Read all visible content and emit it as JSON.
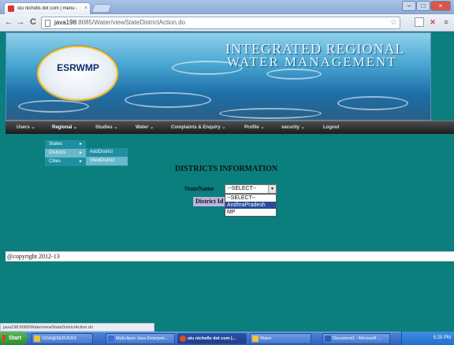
{
  "browser": {
    "tab_title": "stu nicholls dot com | menu - ",
    "tab_close": "×",
    "url_host": "java198",
    "url_rest": ":8085/Water/viewStateDistrictAction.do",
    "window_min": "–",
    "window_max": "□",
    "window_close": "×",
    "back": "←",
    "forward": "→",
    "reload": "C",
    "star": "☆"
  },
  "banner": {
    "logo_text": "ESRWMP",
    "title_line1": "INTEGRATED REGIONAL",
    "title_line2": "WATER MANAGEMENT"
  },
  "menu": {
    "items": [
      {
        "label": "Users ⌄"
      },
      {
        "label": "Regional ⌄"
      },
      {
        "label": "Studies ⌄"
      },
      {
        "label": "Water ⌄"
      },
      {
        "label": "Complaints & Enquiry ⌄"
      },
      {
        "label": "Profile ⌄"
      },
      {
        "label": "security ⌄"
      },
      {
        "label": "Logout"
      }
    ],
    "submenu": [
      {
        "label": "States",
        "arrow": "►"
      },
      {
        "label": "Districts",
        "arrow": "►"
      },
      {
        "label": "Cities",
        "arrow": "►"
      }
    ],
    "submenu2": [
      {
        "label": "AddDistrict"
      },
      {
        "label": "ViewDistrict"
      }
    ]
  },
  "form": {
    "heading": "DISTRICTS INFORMATION",
    "state_label": "StateName",
    "select_value": "--SELECT--",
    "options": [
      "--SELECT--",
      "AndhraPradesh",
      "MP"
    ],
    "district_label": "District Id"
  },
  "footer": {
    "text": "@copyright 2012-13"
  },
  "status_bar": {
    "text": "java198:8085/Water/viewStateDistrictAction.do"
  },
  "taskbar": {
    "start": "Start",
    "tasks": [
      {
        "label": "ISSA@SERVER3",
        "color": "#e8c33a"
      },
      {
        "label": "MyEclipse Java Enterpris...",
        "color": "#3a6fd0"
      },
      {
        "label": "stu nicholls dot com |...",
        "color": "#e04a2a"
      },
      {
        "label": "Water",
        "color": "#f0c040"
      },
      {
        "label": "Document1 - Microsoft ...",
        "color": "#2b5fb3"
      }
    ],
    "clock": "5:25 PM"
  },
  "colors": {
    "page_background": "#0b7e7e",
    "submenu_background": "#1e8fa3",
    "submenu_highlight": "#6ab8c9",
    "option_highlight": "#2a4a9a"
  }
}
